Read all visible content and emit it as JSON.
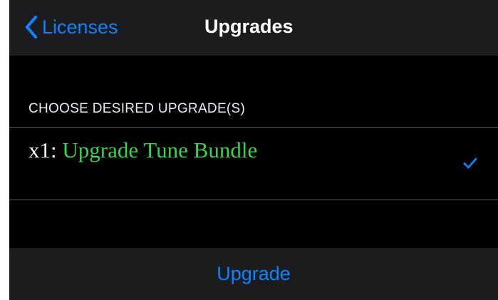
{
  "navbar": {
    "back_label": "Licenses",
    "title": "Upgrades",
    "back_icon": "chevron-left-icon"
  },
  "section": {
    "header": "CHOOSE DESIRED UPGRADE(S)"
  },
  "upgrades": [
    {
      "quantity": "x1:",
      "name": "Upgrade Tune Bundle",
      "selected": true,
      "check_icon": "checkmark-icon"
    }
  ],
  "toolbar": {
    "upgrade_label": "Upgrade"
  },
  "colors": {
    "accent": "#0a84ff",
    "item_name": "#32d74b",
    "background": "#000000",
    "bar_background": "#1c1c1e",
    "separator": "#5a5a5e"
  }
}
